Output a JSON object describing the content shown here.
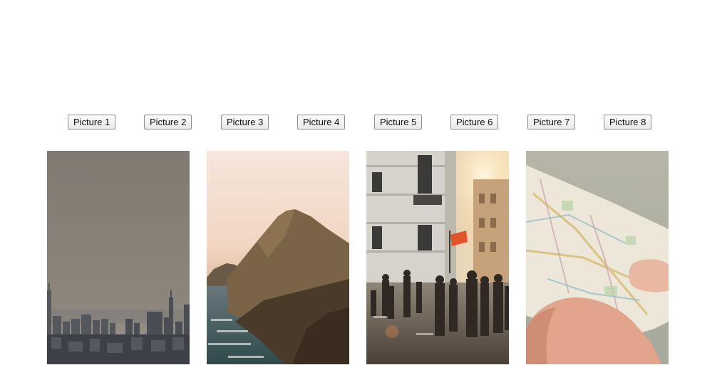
{
  "buttons": [
    {
      "label": "Picture 1"
    },
    {
      "label": "Picture 2"
    },
    {
      "label": "Picture 3"
    },
    {
      "label": "Picture 4"
    },
    {
      "label": "Picture 5"
    },
    {
      "label": "Picture 6"
    },
    {
      "label": "Picture 7"
    },
    {
      "label": "Picture 8"
    }
  ],
  "photos": [
    {
      "subject": "city-skyline"
    },
    {
      "subject": "coastal-cliff"
    },
    {
      "subject": "street-crowd"
    },
    {
      "subject": "map-in-hand"
    }
  ]
}
